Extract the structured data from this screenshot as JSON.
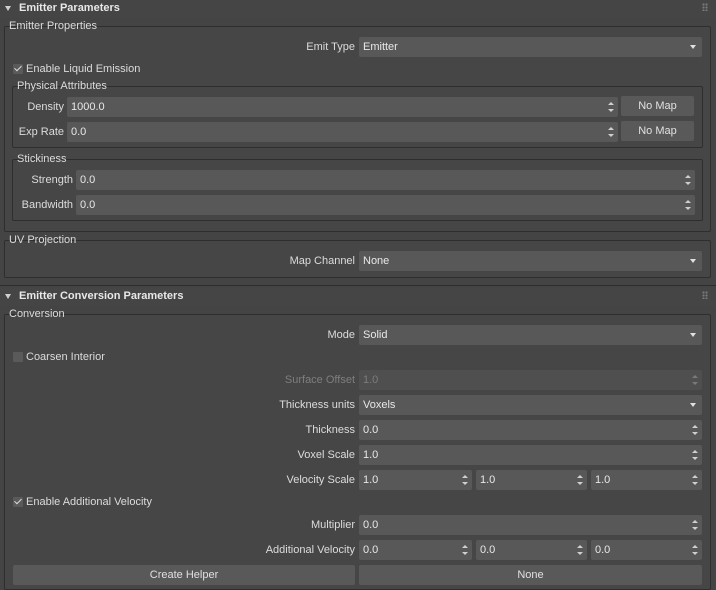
{
  "emitter_parameters": {
    "title": "Emitter Parameters",
    "emitter_properties": {
      "title": "Emitter Properties",
      "emit_type_label": "Emit Type",
      "emit_type_value": "Emitter",
      "enable_liquid_label": "Enable Liquid Emission",
      "enable_liquid_checked": true
    },
    "physical_attributes": {
      "title": "Physical Attributes",
      "density_label": "Density",
      "density_value": "1000.0",
      "density_map": "No Map",
      "exp_rate_label": "Exp Rate",
      "exp_rate_value": "0.0",
      "exp_rate_map": "No Map"
    },
    "stickiness": {
      "title": "Stickiness",
      "strength_label": "Strength",
      "strength_value": "0.0",
      "bandwidth_label": "Bandwidth",
      "bandwidth_value": "0.0"
    },
    "uv_projection": {
      "title": "UV Projection",
      "map_channel_label": "Map Channel",
      "map_channel_value": "None"
    }
  },
  "conversion_parameters": {
    "title": "Emitter Conversion Parameters",
    "conversion": {
      "title": "Conversion",
      "mode_label": "Mode",
      "mode_value": "Solid",
      "coarsen_label": "Coarsen Interior",
      "coarsen_checked": false,
      "surface_offset_label": "Surface Offset",
      "surface_offset_value": "1.0",
      "thickness_units_label": "Thickness units",
      "thickness_units_value": "Voxels",
      "thickness_label": "Thickness",
      "thickness_value": "0.0",
      "voxel_scale_label": "Voxel Scale",
      "voxel_scale_value": "1.0",
      "velocity_scale_label": "Velocity Scale",
      "velocity_scale_values": [
        "1.0",
        "1.0",
        "1.0"
      ],
      "enable_velocity_label": "Enable Additional Velocity",
      "enable_velocity_checked": true,
      "multiplier_label": "Multiplier",
      "multiplier_value": "0.0",
      "additional_velocity_label": "Additional Velocity",
      "additional_velocity_values": [
        "0.0",
        "0.0",
        "0.0"
      ],
      "create_helper_label": "Create Helper",
      "helper_value": "None"
    }
  }
}
